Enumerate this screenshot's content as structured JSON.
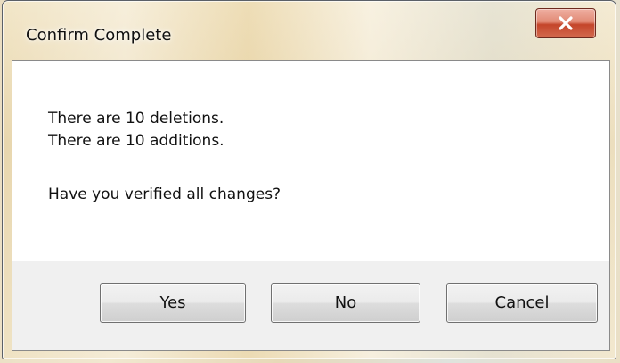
{
  "window": {
    "title": "Confirm Complete",
    "close_icon": "close-x-icon"
  },
  "message": {
    "line1": "There are 10 deletions.",
    "line2": "There are 10 additions.",
    "question": "Have you verified all changes?"
  },
  "buttons": {
    "yes": "Yes",
    "no": "No",
    "cancel": "Cancel"
  },
  "colors": {
    "close_button": "#c4452a",
    "button_bar": "#f0f0f0",
    "client_background": "#ffffff"
  }
}
